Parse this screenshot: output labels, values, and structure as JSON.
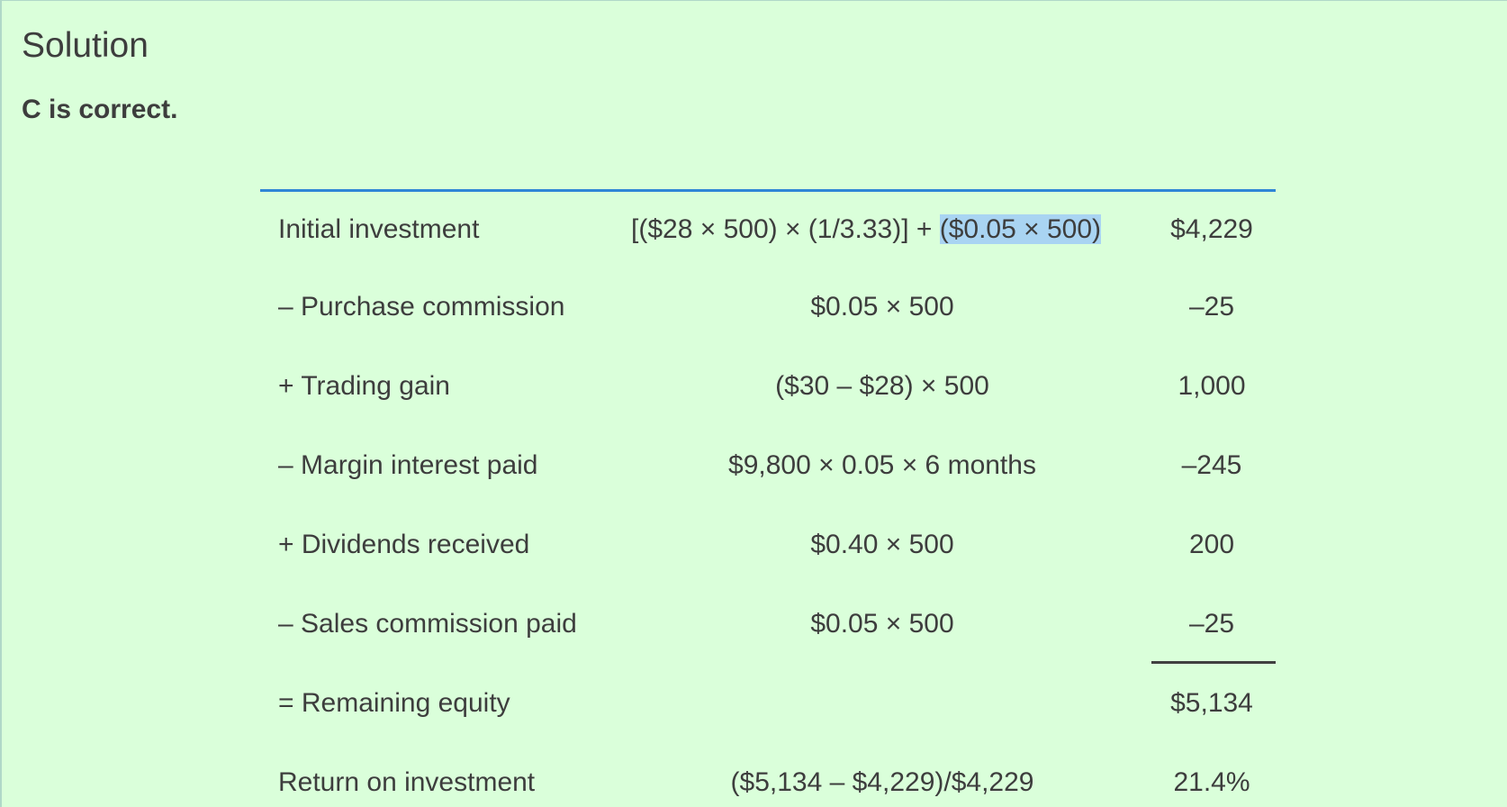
{
  "heading": "Solution",
  "verdict": "C is correct.",
  "table": {
    "rows": [
      {
        "label": "Initial investment",
        "formula_pre": "[($28 × 500) × (1/3.33)] + ",
        "formula_highlight": "($0.05 × 500)",
        "value": "$4,229"
      },
      {
        "label": "– Purchase commission",
        "formula": "$0.05 × 500",
        "value": "–25"
      },
      {
        "label": "+ Trading gain",
        "formula": "($30 – $28) × 500",
        "value": "1,000"
      },
      {
        "label": "– Margin interest paid",
        "formula": "$9,800 × 0.05 × 6 months",
        "value": "–245"
      },
      {
        "label": "+ Dividends received",
        "formula": "$0.40 × 500",
        "value": "200"
      },
      {
        "label": "– Sales commission paid",
        "formula": "$0.05 × 500",
        "value": "–25"
      },
      {
        "label": "= Remaining equity",
        "formula": "",
        "value": "$5,134"
      },
      {
        "label": "Return on investment",
        "formula": "($5,134 – $4,229)/$4,229",
        "value": "21.4%"
      }
    ]
  },
  "colors": {
    "background": "#daffda",
    "table_rule": "#2f86d6",
    "text_highlight": "#a9d4f2"
  }
}
